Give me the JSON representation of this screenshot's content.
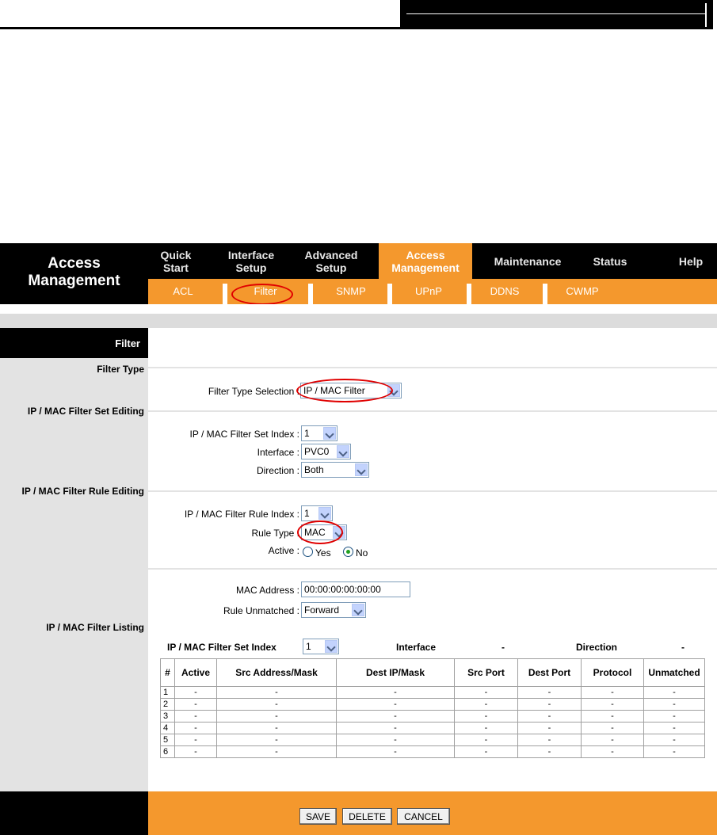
{
  "brand": {
    "line1": "Access",
    "line2": "Management"
  },
  "top_nav": [
    {
      "line1": "Quick",
      "line2": "Start"
    },
    {
      "line1": "Interface",
      "line2": "Setup"
    },
    {
      "line1": "Advanced",
      "line2": "Setup"
    },
    {
      "line1": "Access",
      "line2": "Management"
    },
    {
      "line1": "Maintenance",
      "line2": ""
    },
    {
      "line1": "Status",
      "line2": ""
    },
    {
      "line1": "Help",
      "line2": ""
    }
  ],
  "sub_nav": [
    "ACL",
    "Filter",
    "SNMP",
    "UPnP",
    "DDNS",
    "CWMP"
  ],
  "section": {
    "title": "Filter",
    "filter_type": "Filter Type",
    "set_editing": "IP / MAC Filter Set Editing",
    "rule_editing": "IP / MAC Filter Rule Editing",
    "listing": "IP / MAC Filter Listing"
  },
  "fields": {
    "filter_type_selection": {
      "label": "Filter Type Selection :",
      "value": "IP / MAC Filter"
    },
    "set_index": {
      "label": "IP / MAC Filter Set Index :",
      "value": "1"
    },
    "interface": {
      "label": "Interface :",
      "value": "PVC0"
    },
    "direction": {
      "label": "Direction :",
      "value": "Both"
    },
    "rule_index": {
      "label": "IP / MAC Filter Rule Index :",
      "value": "1"
    },
    "rule_type": {
      "label": "Rule Type :",
      "value": "MAC"
    },
    "active": {
      "label": "Active :",
      "yes": "Yes",
      "no": "No",
      "selected": "No"
    },
    "mac_address": {
      "label": "MAC Address :",
      "value": "00:00:00:00:00:00"
    },
    "rule_unmatched": {
      "label": "Rule Unmatched :",
      "value": "Forward"
    }
  },
  "listing": {
    "set_index_label": "IP / MAC Filter Set Index",
    "set_index_value": "1",
    "interface_label": "Interface",
    "interface_value": "-",
    "direction_label": "Direction",
    "direction_value": "-",
    "columns": [
      "#",
      "Active",
      "Src Address/Mask",
      "Dest IP/Mask",
      "Src Port",
      "Dest Port",
      "Protocol",
      "Unmatched"
    ],
    "rows": [
      [
        "1",
        "-",
        "-",
        "-",
        "-",
        "-",
        "-",
        "-"
      ],
      [
        "2",
        "-",
        "-",
        "-",
        "-",
        "-",
        "-",
        "-"
      ],
      [
        "3",
        "-",
        "-",
        "-",
        "-",
        "-",
        "-",
        "-"
      ],
      [
        "4",
        "-",
        "-",
        "-",
        "-",
        "-",
        "-",
        "-"
      ],
      [
        "5",
        "-",
        "-",
        "-",
        "-",
        "-",
        "-",
        "-"
      ],
      [
        "6",
        "-",
        "-",
        "-",
        "-",
        "-",
        "-",
        "-"
      ]
    ]
  },
  "buttons": {
    "save": "SAVE",
    "delete": "DELETE",
    "cancel": "CANCEL"
  },
  "colors": {
    "accent": "#f4982d",
    "highlight_circle": "#e00000"
  }
}
